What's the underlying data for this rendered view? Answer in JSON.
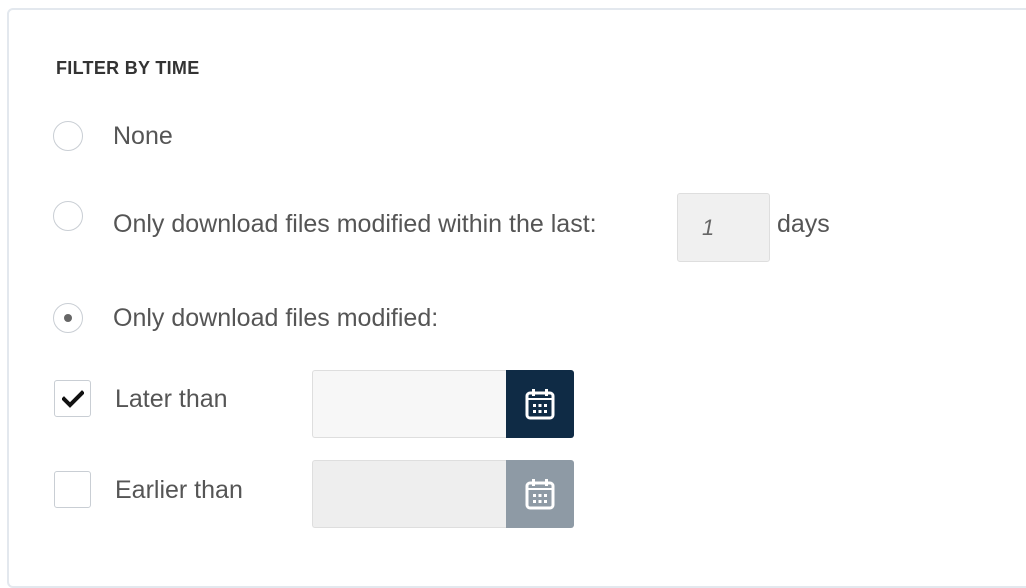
{
  "section": {
    "title": "FILTER BY TIME"
  },
  "options": {
    "none": {
      "label": "None",
      "selected": false
    },
    "within_last": {
      "label": "Only download files modified within the last:",
      "days_value": "1",
      "days_unit": "days",
      "selected": false
    },
    "modified": {
      "label": "Only download files modified:",
      "selected": true
    }
  },
  "date_filters": {
    "later_than": {
      "label": "Later than",
      "checked": true,
      "value": "",
      "enabled": true
    },
    "earlier_than": {
      "label": "Earlier than",
      "checked": false,
      "value": "",
      "enabled": false
    }
  },
  "icons": {
    "calendar": "calendar-icon",
    "check": "checkmark-icon"
  },
  "colors": {
    "calendar_active": "#0f2b45",
    "calendar_disabled": "#8e9aa5",
    "field_disabled": "#eeeeee"
  }
}
